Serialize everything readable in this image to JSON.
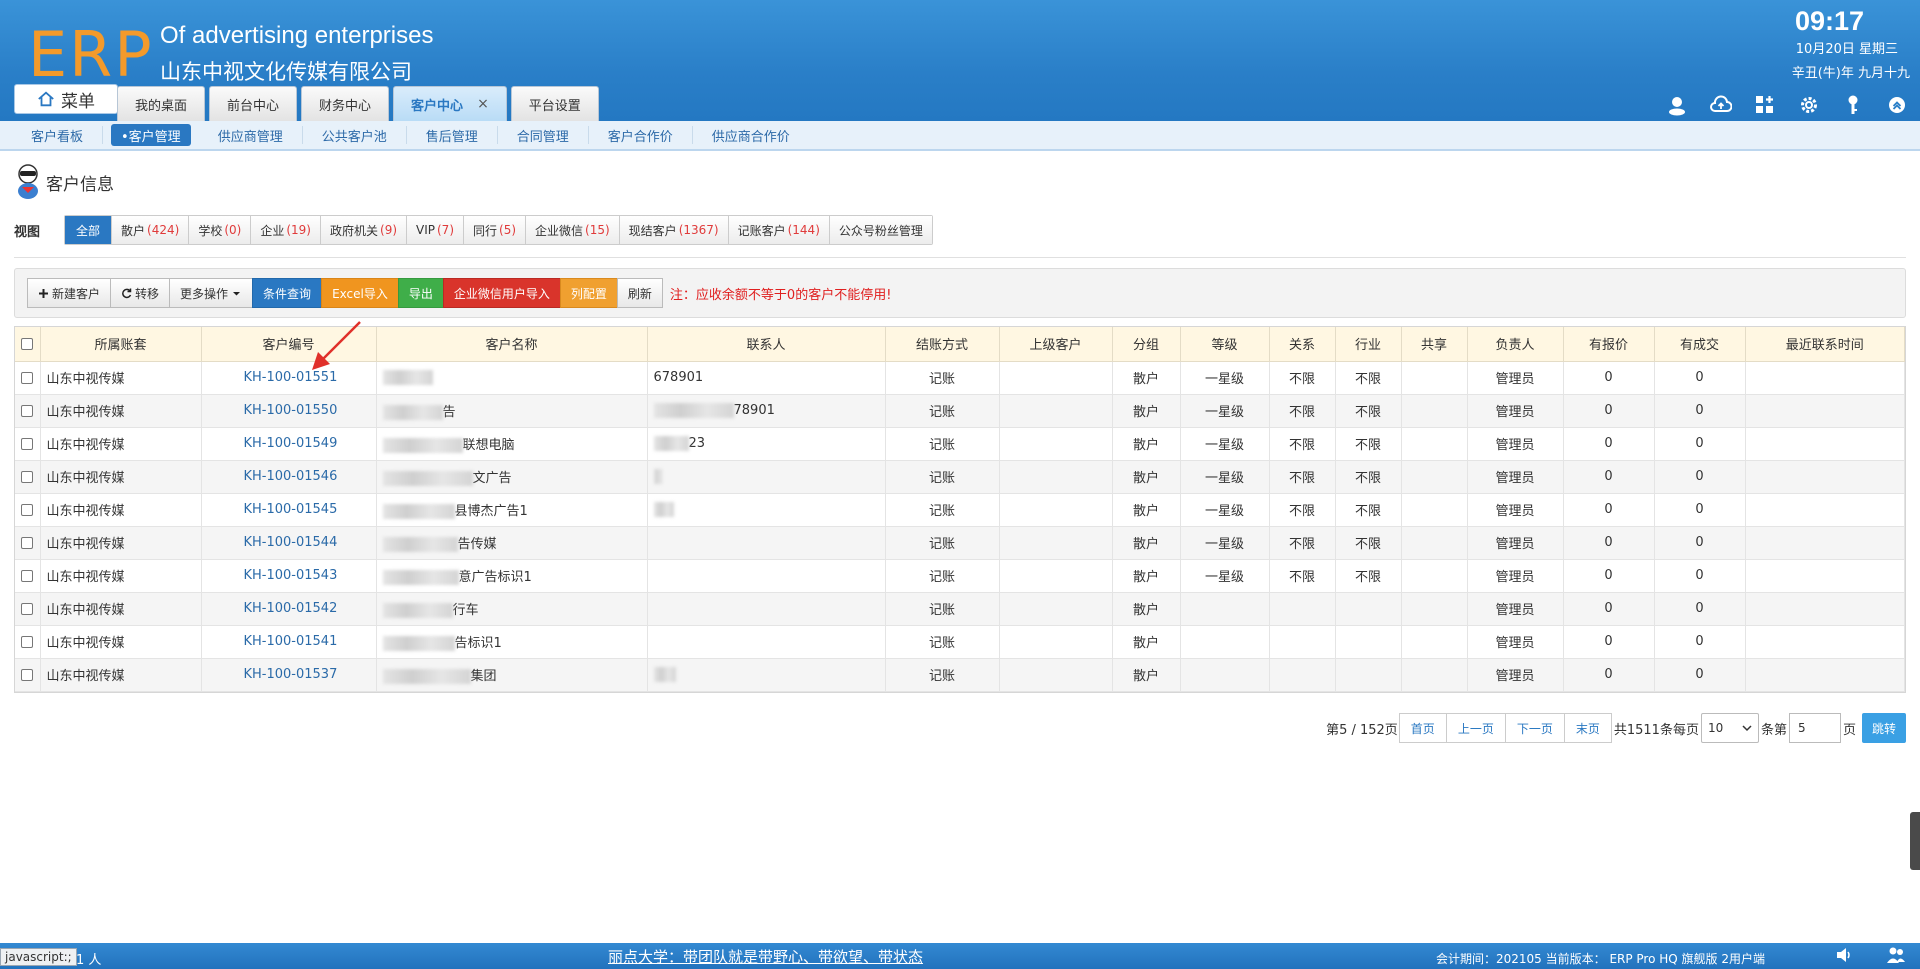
{
  "header": {
    "logo": "ERP",
    "company_en": "Of advertising enterprises",
    "company_cn": "山东中视文化传媒有限公司",
    "time": "09:17",
    "date": "10月20日 星期三",
    "lunar": "辛丑(牛)年 九月十九",
    "menu_label": "菜单",
    "tabs": [
      {
        "label": "我的桌面"
      },
      {
        "label": "前台中心"
      },
      {
        "label": "财务中心"
      },
      {
        "label": "客户中心",
        "close": "×"
      },
      {
        "label": "平台设置"
      }
    ]
  },
  "subnav": [
    "客户看板",
    "•客户管理",
    "供应商管理",
    "公共客户池",
    "售后管理",
    "合同管理",
    "客户合作价",
    "供应商合作价"
  ],
  "page_title": "客户信息",
  "view": {
    "label": "视图",
    "tabs": [
      {
        "label": "全部",
        "count": ""
      },
      {
        "label": "散户",
        "count": "(424)"
      },
      {
        "label": "学校",
        "count": "(0)"
      },
      {
        "label": "企业",
        "count": "(19)"
      },
      {
        "label": "政府机关",
        "count": "(9)"
      },
      {
        "label": "VIP",
        "count": "(7)"
      },
      {
        "label": "同行",
        "count": "(5)"
      },
      {
        "label": "企业微信",
        "count": "(15)"
      },
      {
        "label": "现结客户",
        "count": "(1367)"
      },
      {
        "label": "记账客户",
        "count": "(144)"
      },
      {
        "label": "公众号粉丝管理",
        "count": ""
      }
    ]
  },
  "toolbar": {
    "new": "新建客户",
    "transfer": "转移",
    "more": "更多操作",
    "query": "条件查询",
    "excel_import": "Excel导入",
    "export": "导出",
    "wechat_import": "企业微信用户导入",
    "columns": "列配置",
    "refresh": "刷新",
    "warning": "注：应收余额不等于0的客户不能停用!"
  },
  "table": {
    "headers": [
      "所属账套",
      "客户编号",
      "客户名称",
      "联系人",
      "结账方式",
      "上级客户",
      "分组",
      "等级",
      "关系",
      "行业",
      "共享",
      "负责人",
      "有报价",
      "有成交",
      "最近联系时间"
    ],
    "rows": [
      {
        "account": "山东中视传媒",
        "code": "KH-100-01551",
        "name": "",
        "contact": "678901",
        "settle": "记账",
        "parent": "",
        "group": "散户",
        "level": "一星级",
        "relation": "不限",
        "industry": "不限",
        "share": "",
        "owner": "管理员",
        "quoted": "0",
        "deal": "0",
        "last": ""
      },
      {
        "account": "山东中视传媒",
        "code": "KH-100-01550",
        "name": "告",
        "contact": "78901",
        "settle": "记账",
        "parent": "",
        "group": "散户",
        "level": "一星级",
        "relation": "不限",
        "industry": "不限",
        "share": "",
        "owner": "管理员",
        "quoted": "0",
        "deal": "0",
        "last": ""
      },
      {
        "account": "山东中视传媒",
        "code": "KH-100-01549",
        "name": "联想电脑",
        "contact": "23",
        "settle": "记账",
        "parent": "",
        "group": "散户",
        "level": "一星级",
        "relation": "不限",
        "industry": "不限",
        "share": "",
        "owner": "管理员",
        "quoted": "0",
        "deal": "0",
        "last": ""
      },
      {
        "account": "山东中视传媒",
        "code": "KH-100-01546",
        "name": "文广告",
        "contact": "",
        "settle": "记账",
        "parent": "",
        "group": "散户",
        "level": "一星级",
        "relation": "不限",
        "industry": "不限",
        "share": "",
        "owner": "管理员",
        "quoted": "0",
        "deal": "0",
        "last": ""
      },
      {
        "account": "山东中视传媒",
        "code": "KH-100-01545",
        "name": "县博杰广告1",
        "contact": "",
        "settle": "记账",
        "parent": "",
        "group": "散户",
        "level": "一星级",
        "relation": "不限",
        "industry": "不限",
        "share": "",
        "owner": "管理员",
        "quoted": "0",
        "deal": "0",
        "last": ""
      },
      {
        "account": "山东中视传媒",
        "code": "KH-100-01544",
        "name": "告传媒",
        "contact": "",
        "settle": "记账",
        "parent": "",
        "group": "散户",
        "level": "一星级",
        "relation": "不限",
        "industry": "不限",
        "share": "",
        "owner": "管理员",
        "quoted": "0",
        "deal": "0",
        "last": ""
      },
      {
        "account": "山东中视传媒",
        "code": "KH-100-01543",
        "name": "意广告标识1",
        "contact": "",
        "settle": "记账",
        "parent": "",
        "group": "散户",
        "level": "一星级",
        "relation": "不限",
        "industry": "不限",
        "share": "",
        "owner": "管理员",
        "quoted": "0",
        "deal": "0",
        "last": ""
      },
      {
        "account": "山东中视传媒",
        "code": "KH-100-01542",
        "name": "行车",
        "contact": "",
        "settle": "记账",
        "parent": "",
        "group": "散户",
        "level": "",
        "relation": "",
        "industry": "",
        "share": "",
        "owner": "管理员",
        "quoted": "0",
        "deal": "0",
        "last": ""
      },
      {
        "account": "山东中视传媒",
        "code": "KH-100-01541",
        "name": "告标识1",
        "contact": "",
        "settle": "记账",
        "parent": "",
        "group": "散户",
        "level": "",
        "relation": "",
        "industry": "",
        "share": "",
        "owner": "管理员",
        "quoted": "0",
        "deal": "0",
        "last": ""
      },
      {
        "account": "山东中视传媒",
        "code": "KH-100-01537",
        "name": "集团",
        "contact": "",
        "settle": "记账",
        "parent": "",
        "group": "散户",
        "level": "",
        "relation": "",
        "industry": "",
        "share": "",
        "owner": "管理员",
        "quoted": "0",
        "deal": "0",
        "last": ""
      }
    ]
  },
  "pager": {
    "info": "第5 / 152页",
    "first": "首页",
    "prev": "上一页",
    "next": "下一页",
    "last": "末页",
    "total": "共1511条每页",
    "per_page": "10",
    "unit": "条第",
    "page_input": "5",
    "page_suffix": "页",
    "jump": "跳转"
  },
  "footer": {
    "status_tip": "javascript:;",
    "online": "1  人",
    "marquee": "丽点大学：带团队就是带野心、带欲望、带状态",
    "version": "会计期间：202105 当前版本： ERP Pro HQ 旗舰版 2用户端"
  },
  "colors": {
    "header_blue": "#2a7fc8",
    "logo_orange": "#f39a2b",
    "accent": "#2a78c2",
    "warning_red": "#e02020"
  }
}
